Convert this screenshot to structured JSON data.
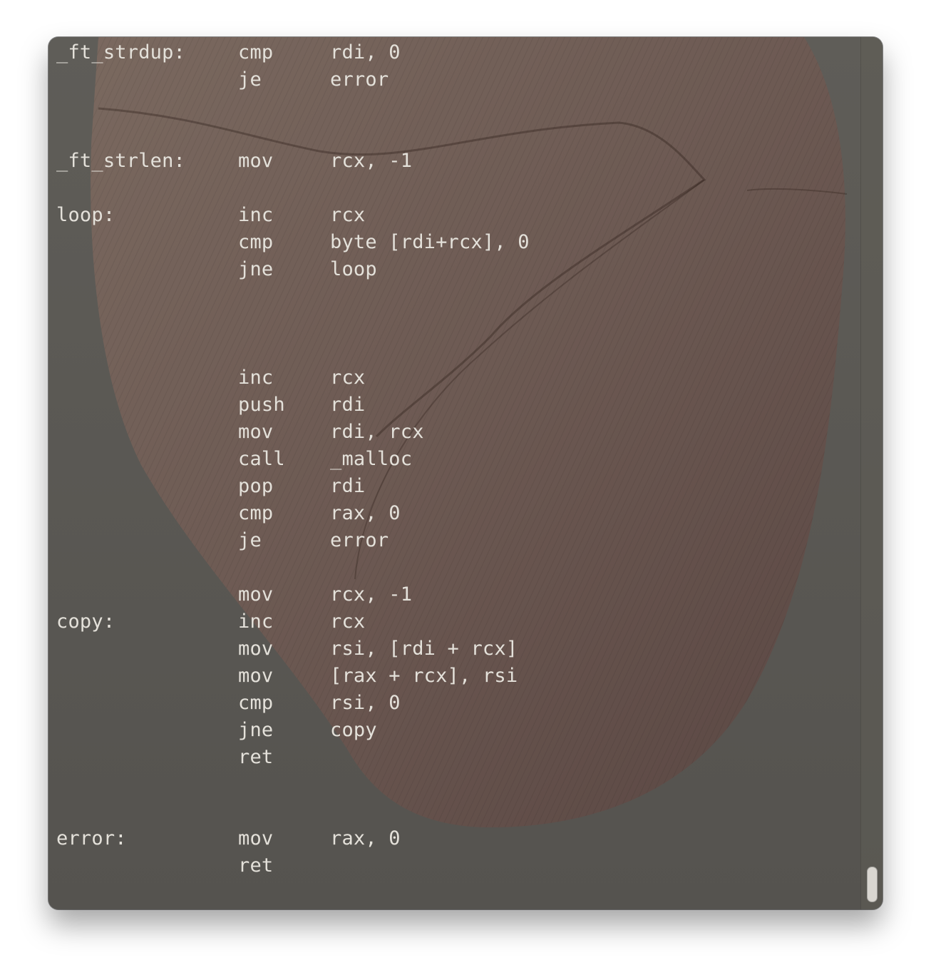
{
  "terminal": {
    "lines": [
      {
        "label": "_ft_strdup:",
        "op": "cmp",
        "arg": "rdi, 0"
      },
      {
        "label": "",
        "op": "je",
        "arg": "error"
      },
      {
        "label": "",
        "op": "",
        "arg": ""
      },
      {
        "label": "",
        "op": "",
        "arg": ""
      },
      {
        "label": "_ft_strlen:",
        "op": "mov",
        "arg": "rcx, -1"
      },
      {
        "label": "",
        "op": "",
        "arg": ""
      },
      {
        "label": "loop:",
        "op": "inc",
        "arg": "rcx"
      },
      {
        "label": "",
        "op": "cmp",
        "arg": "byte [rdi+rcx], 0"
      },
      {
        "label": "",
        "op": "jne",
        "arg": "loop"
      },
      {
        "label": "",
        "op": "",
        "arg": ""
      },
      {
        "label": "",
        "op": "",
        "arg": ""
      },
      {
        "label": "",
        "op": "",
        "arg": ""
      },
      {
        "label": "",
        "op": "inc",
        "arg": "rcx"
      },
      {
        "label": "",
        "op": "push",
        "arg": "rdi"
      },
      {
        "label": "",
        "op": "mov",
        "arg": "rdi, rcx"
      },
      {
        "label": "",
        "op": "call",
        "arg": "_malloc"
      },
      {
        "label": "",
        "op": "pop",
        "arg": "rdi"
      },
      {
        "label": "",
        "op": "cmp",
        "arg": "rax, 0"
      },
      {
        "label": "",
        "op": "je",
        "arg": "error"
      },
      {
        "label": "",
        "op": "",
        "arg": ""
      },
      {
        "label": "",
        "op": "mov",
        "arg": "rcx, -1"
      },
      {
        "label": "copy:",
        "op": "inc",
        "arg": "rcx"
      },
      {
        "label": "",
        "op": "mov",
        "arg": "rsi, [rdi + rcx]"
      },
      {
        "label": "",
        "op": "mov",
        "arg": "[rax + rcx], rsi"
      },
      {
        "label": "",
        "op": "cmp",
        "arg": "rsi, 0"
      },
      {
        "label": "",
        "op": "jne",
        "arg": "copy"
      },
      {
        "label": "",
        "op": "ret",
        "arg": ""
      },
      {
        "label": "",
        "op": "",
        "arg": ""
      },
      {
        "label": "",
        "op": "",
        "arg": ""
      },
      {
        "label": "error:",
        "op": "mov",
        "arg": "rax, 0"
      },
      {
        "label": "",
        "op": "ret",
        "arg": ""
      }
    ]
  },
  "colors": {
    "background": "#5c5a55",
    "text": "#e4e1da",
    "wallpaper_tint": "#7a5a52"
  },
  "icons": {
    "scrollbar": "scrollbar-thumb"
  }
}
